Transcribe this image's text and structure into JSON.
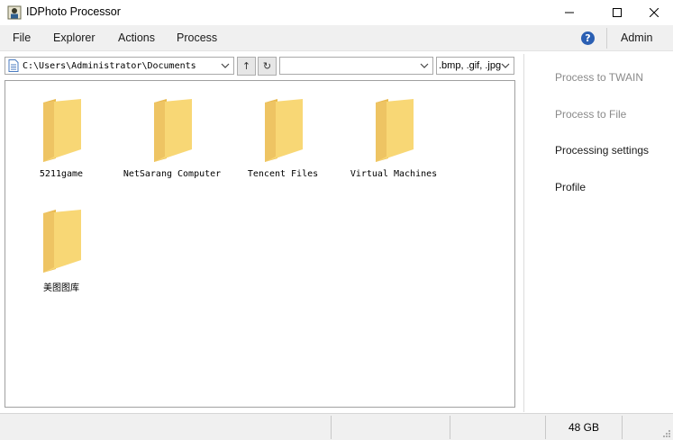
{
  "window": {
    "title": "IDPhoto Processor",
    "icon": "idphoto-app-icon",
    "controls": [
      "minimize-icon",
      "maximize-icon",
      "close-icon"
    ]
  },
  "menu": {
    "items": [
      "File",
      "Explorer",
      "Actions",
      "Process"
    ],
    "help_icon": "?",
    "user": "Admin"
  },
  "toolbar": {
    "path": "C:\\Users\\Administrator\\Documents",
    "up_glyph": "↑",
    "refresh_glyph": "↻",
    "filter_value": "",
    "extensions": ".bmp, .gif, .jpg"
  },
  "files": [
    {
      "name": "5211game"
    },
    {
      "name": "NetSarang Computer"
    },
    {
      "name": "Tencent Files"
    },
    {
      "name": "Virtual Machines"
    },
    {
      "name": "美图图库"
    }
  ],
  "side_panel": {
    "items": [
      {
        "label": "Process to TWAIN",
        "enabled": false
      },
      {
        "label": "Process to File",
        "enabled": false
      },
      {
        "label": "Processing settings",
        "enabled": true
      },
      {
        "label": "Profile",
        "enabled": true
      }
    ]
  },
  "status": {
    "free_space": "48 GB"
  },
  "colors": {
    "folder_front": "#f8d775",
    "folder_back": "#e8b84a",
    "help_blue": "#2b5fb3"
  }
}
